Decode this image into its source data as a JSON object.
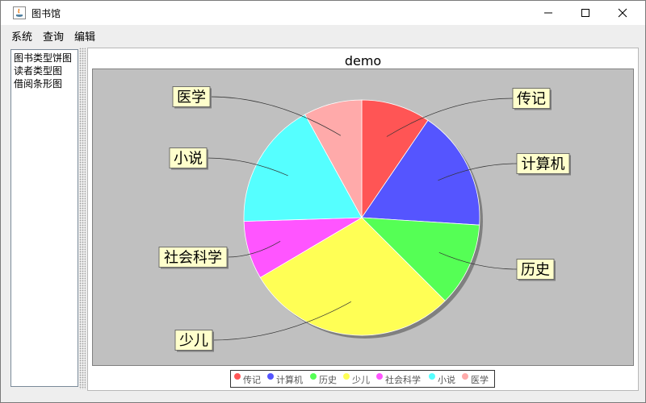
{
  "window": {
    "title": "图书馆",
    "minimize_icon": "minimize-icon",
    "maximize_icon": "maximize-icon",
    "close_icon": "close-icon"
  },
  "menu": [
    "系统",
    "查询",
    "编辑"
  ],
  "tree": [
    "图书类型饼图",
    "读者类型图",
    "借阅条形图"
  ],
  "colors": {
    "传记": "#ff5555",
    "计算机": "#5555ff",
    "历史": "#55ff55",
    "少儿": "#ffff55",
    "社会科学": "#ff55ff",
    "小说": "#55ffff",
    "医学": "#ffaaaa",
    "plot_background": "#c0c0c0",
    "label_background": "#ffffcc"
  },
  "chart_data": {
    "type": "pie",
    "title": "demo",
    "categories": [
      "传记",
      "计算机",
      "历史",
      "少儿",
      "社会科学",
      "小说",
      "医学"
    ],
    "values": [
      9.5,
      16.5,
      11.5,
      29,
      8,
      17.5,
      8
    ],
    "legend_placement": "bottom"
  }
}
